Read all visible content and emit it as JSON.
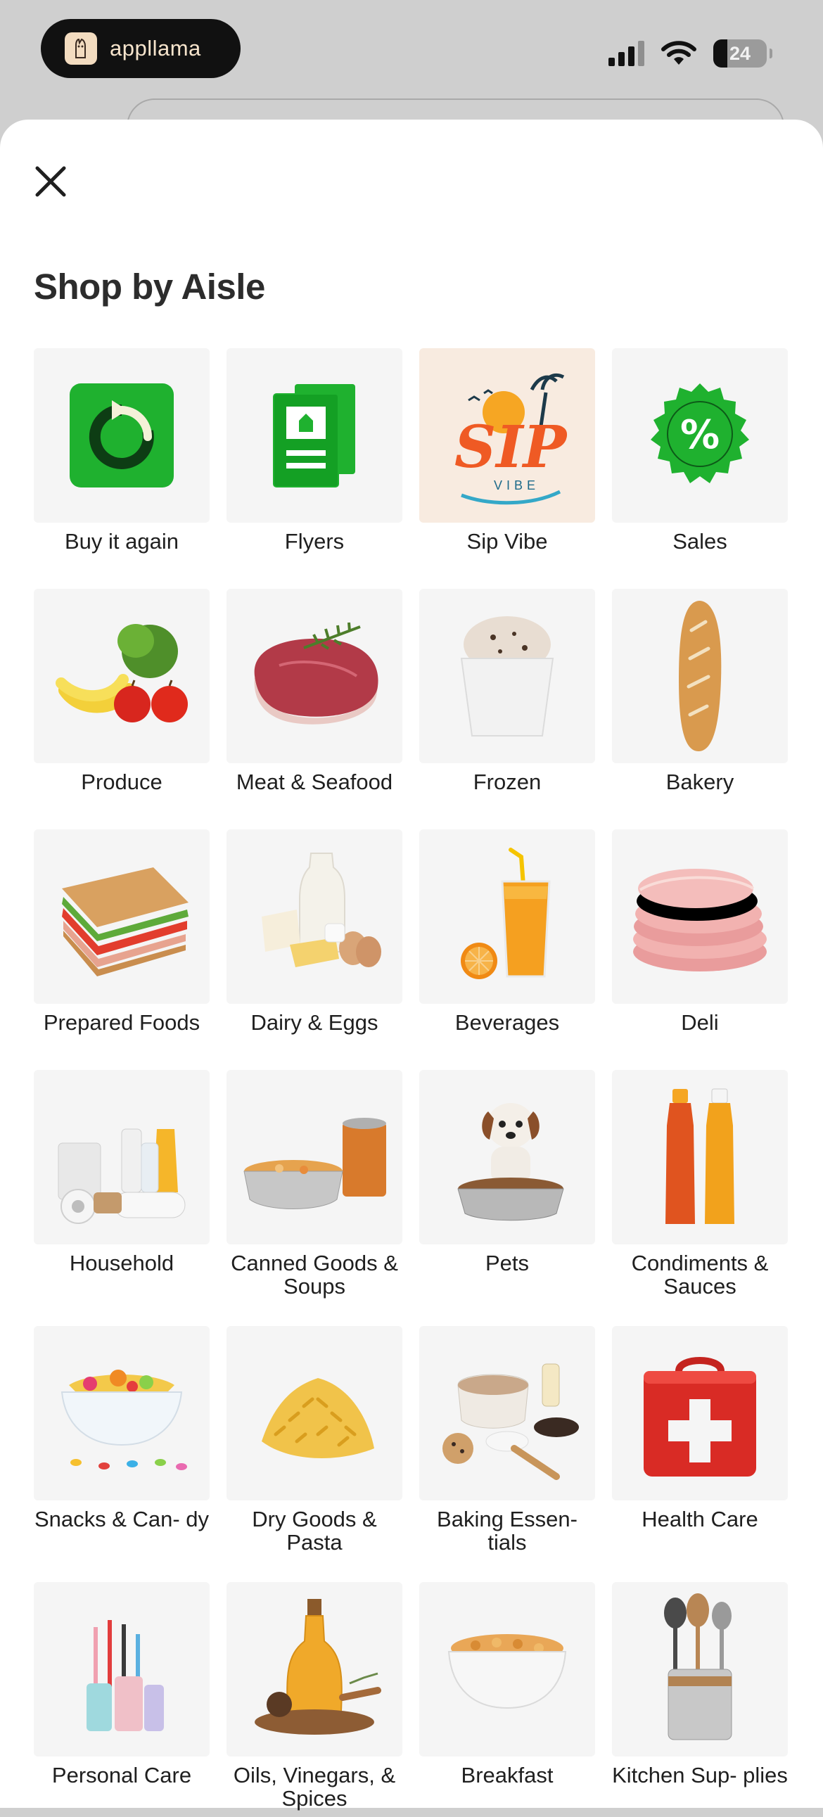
{
  "status_bar": {
    "app_name": "appllama",
    "battery": "24"
  },
  "sheet": {
    "title": "Shop by Aisle",
    "aisles": [
      {
        "label": "Buy it again",
        "icon": "buy-again-icon"
      },
      {
        "label": "Flyers",
        "icon": "flyers-icon"
      },
      {
        "label": "Sip Vibe",
        "icon": "sip-vibe-logo"
      },
      {
        "label": "Sales",
        "icon": "sales-badge-icon"
      },
      {
        "label": "Produce",
        "icon": "produce-image"
      },
      {
        "label": "Meat & Seafood",
        "icon": "meat-image"
      },
      {
        "label": "Frozen",
        "icon": "ice-cream-image"
      },
      {
        "label": "Bakery",
        "icon": "baguette-image"
      },
      {
        "label": "Prepared Foods",
        "icon": "sandwich-image"
      },
      {
        "label": "Dairy & Eggs",
        "icon": "dairy-image"
      },
      {
        "label": "Beverages",
        "icon": "juice-image"
      },
      {
        "label": "Deli",
        "icon": "ham-slices-image"
      },
      {
        "label": "Household",
        "icon": "household-image"
      },
      {
        "label": "Canned Goods & Soups",
        "icon": "canned-goods-image"
      },
      {
        "label": "Pets",
        "icon": "puppy-image"
      },
      {
        "label": "Condiments & Sauces",
        "icon": "sauce-bottles-image"
      },
      {
        "label": "Snacks & Can- dy",
        "icon": "candy-bowl-image"
      },
      {
        "label": "Dry Goods & Pasta",
        "icon": "pasta-image"
      },
      {
        "label": "Baking Essen- tials",
        "icon": "baking-image"
      },
      {
        "label": "Health Care",
        "icon": "first-aid-kit-image"
      },
      {
        "label": "Personal Care",
        "icon": "toothbrush-image"
      },
      {
        "label": "Oils, Vinegars, & Spices",
        "icon": "oil-bottle-image"
      },
      {
        "label": "Breakfast",
        "icon": "cereal-bowl-image"
      },
      {
        "label": "Kitchen Sup- plies",
        "icon": "utensils-image"
      }
    ]
  },
  "colors": {
    "brand_green": "#1fb12f",
    "text_dark": "#2c2c2c",
    "tile_bg": "#f5f5f5"
  }
}
